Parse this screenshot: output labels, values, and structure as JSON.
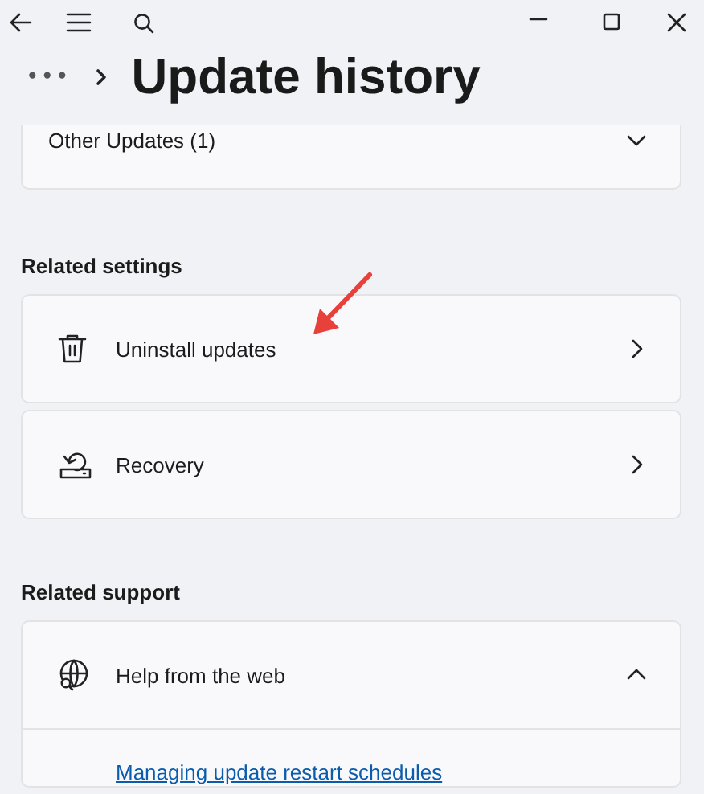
{
  "breadcrumb": {
    "overflow": "•••",
    "title": "Update history"
  },
  "history_group": {
    "label": "Other Updates (1)",
    "expanded": false
  },
  "related_settings": {
    "heading": "Related settings",
    "items": [
      {
        "kind": "trash",
        "label": "Uninstall updates"
      },
      {
        "kind": "recovery",
        "label": "Recovery"
      }
    ]
  },
  "related_support": {
    "heading": "Related support",
    "items": [
      {
        "label": "Help from the web",
        "expanded": true,
        "links": [
          "Managing update restart schedules"
        ]
      }
    ]
  }
}
